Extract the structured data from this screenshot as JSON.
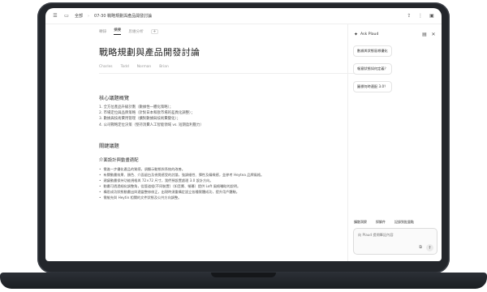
{
  "header": {
    "breadcrumb_root": "全部",
    "breadcrumb_title": "07-30 戰略規劃與產品開發討論"
  },
  "tabs": [
    {
      "label": "轉錄"
    },
    {
      "label": "摘要"
    },
    {
      "label": "思維分析"
    }
  ],
  "document": {
    "title": "戰略規劃與產品開發討論",
    "participants": [
      "Charles",
      "Todd",
      "Norman",
      "Brian"
    ],
    "overview_heading": "核心議題概覽",
    "overview_items": [
      "1. 全方位產品升級計劃（數據性一體化策略）；",
      "2. 市場定位與品牌策略（針對日本和歐市場的差異化調整）；",
      "3. 數據與技術費用管理（擴對數據與技術費變化）；",
      "4. 公司戰略定位決策（堅持消費人工智能領域 vs. 短期盈利壓力）"
    ],
    "record_heading": "關鍵議題",
    "sub_heading": "介面設計與動畫適配",
    "bullets": [
      "需進一步優化產品的質感，須顯示動態與系統的改善。",
      "有關動畫效果、顏色、介面留白及視覺感受的討論，強調細性、彈性及精緻感，並參考 Heytea 品牌風格。",
      "建議動畫保持功能規格與 72×72 尺寸，我們預設置處理 3.0 設計方向。",
      "動畫可透過細化調整角，從管道組(不同裝置)（如音響、螢幕）提供 Loft 風格輔助的說明。",
      "構思成功狀態動畫出與適當整修修正，出現時須重構定設立各種實體成功，提升用戶體驗。",
      "需維先與 Heytin 相關的文件狀態及公共方向調整。"
    ]
  },
  "ask_panel": {
    "title": "Ask Plaud",
    "questions": [
      "數據與狀態區哪優化",
      "報意狀態如何定義？",
      "圖標何時適配 3.0？"
    ],
    "actions": [
      "擴散洞察",
      "探解件",
      "記錄到批量點"
    ],
    "input_placeholder": "向 Plaud 提問筆記內容"
  }
}
